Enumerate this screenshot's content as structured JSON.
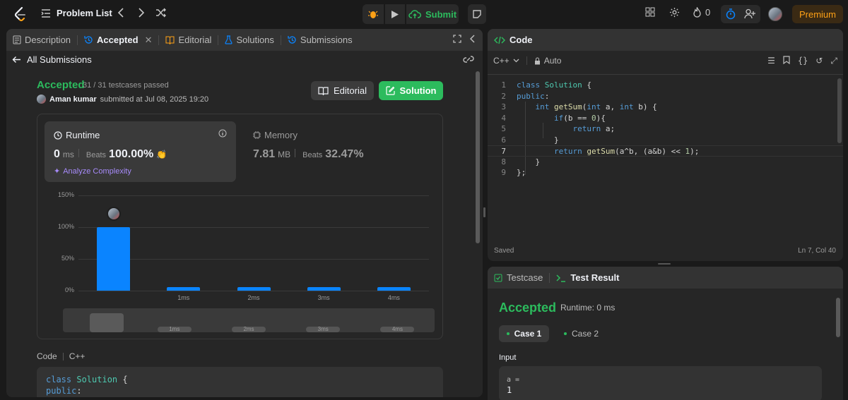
{
  "topbar": {
    "problem_list": "Problem List",
    "submit": "Submit",
    "streak": "0",
    "premium": "Premium"
  },
  "left_tabs": [
    {
      "label": "Description"
    },
    {
      "label": "Accepted"
    },
    {
      "label": "Editorial"
    },
    {
      "label": "Solutions"
    },
    {
      "label": "Submissions"
    }
  ],
  "back": {
    "label": "All Submissions"
  },
  "result": {
    "status": "Accepted",
    "testcases": "31 / 31 testcases passed",
    "user": "Aman kumar",
    "submitted": "submitted at Jul 08, 2025 19:20",
    "editorial_btn": "Editorial",
    "solution_btn": "Solution"
  },
  "runtime": {
    "label": "Runtime",
    "value": "0",
    "unit": "ms",
    "beats_label": "Beats",
    "beats": "100.00%",
    "analyze": "Analyze Complexity"
  },
  "memory": {
    "label": "Memory",
    "value": "7.81",
    "unit": "MB",
    "beats_label": "Beats",
    "beats": "32.47%"
  },
  "chart_data": {
    "type": "bar",
    "categories": [
      "0ms",
      "1ms",
      "2ms",
      "3ms",
      "4ms"
    ],
    "x_tick_labels": [
      "",
      "1ms",
      "2ms",
      "3ms",
      "4ms"
    ],
    "values": [
      100,
      1.5,
      1.5,
      1.5,
      1.5
    ],
    "ylim": [
      0,
      150
    ],
    "yticks": [
      "0%",
      "50%",
      "100%",
      "150%"
    ],
    "bar_color": "#0a84ff",
    "highlight_category": "0ms",
    "overview_labels": [
      "1ms",
      "2ms",
      "3ms",
      "4ms"
    ]
  },
  "code_section": {
    "label": "Code",
    "lang": "C++",
    "preview": [
      "class Solution {",
      "public:"
    ]
  },
  "editor": {
    "title": "Code",
    "lang": "C++",
    "mode": "Auto",
    "saved": "Saved",
    "position": "Ln 7, Col 40",
    "lines": [
      "1",
      "2",
      "3",
      "4",
      "5",
      "6",
      "7",
      "8",
      "9"
    ]
  },
  "testpanel": {
    "tab_testcase": "Testcase",
    "tab_result": "Test Result",
    "status": "Accepted",
    "runtime": "Runtime: 0 ms",
    "case1": "Case 1",
    "case2": "Case 2",
    "input_label": "Input",
    "input_var": "a =",
    "input_val": "1"
  },
  "colors": {
    "accent_green": "#2cbb5d",
    "accent_orange": "#ffa116",
    "bar_blue": "#0a84ff",
    "purple": "#a78bfa"
  }
}
